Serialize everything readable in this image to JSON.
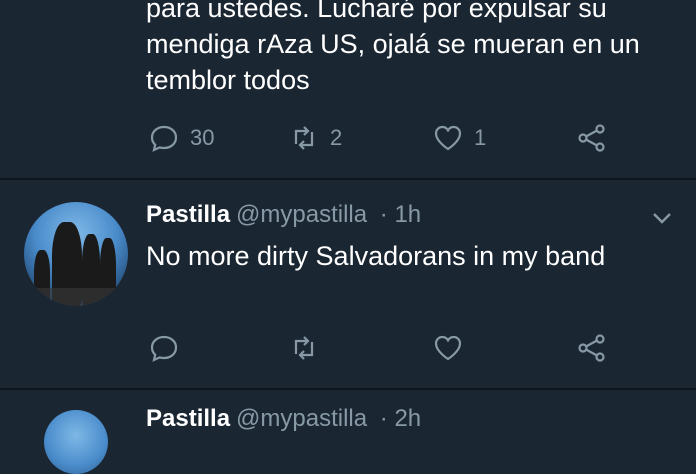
{
  "top_tweet": {
    "text": "para ustedes.  Lucharé por expulsar su\nmendiga rAza US, ojalá se mueran en un\ntemblor todos",
    "replies": "30",
    "retweets": "2",
    "likes": "1"
  },
  "tweet": {
    "name": "Pastilla",
    "handle": "@mypastilla",
    "time": "· 1h",
    "text": "No more dirty Salvadorans in my band"
  },
  "next_tweet": {
    "name": "Pastilla",
    "handle": "@mypastilla",
    "time": "· 2h"
  },
  "icons": {
    "reply": "reply-icon",
    "retweet": "retweet-icon",
    "like": "heart-icon",
    "share": "share-icon",
    "menu": "chevron-down-icon"
  },
  "colors": {
    "background": "#1b2633",
    "muted": "#8899a6",
    "text": "#ffffff"
  }
}
